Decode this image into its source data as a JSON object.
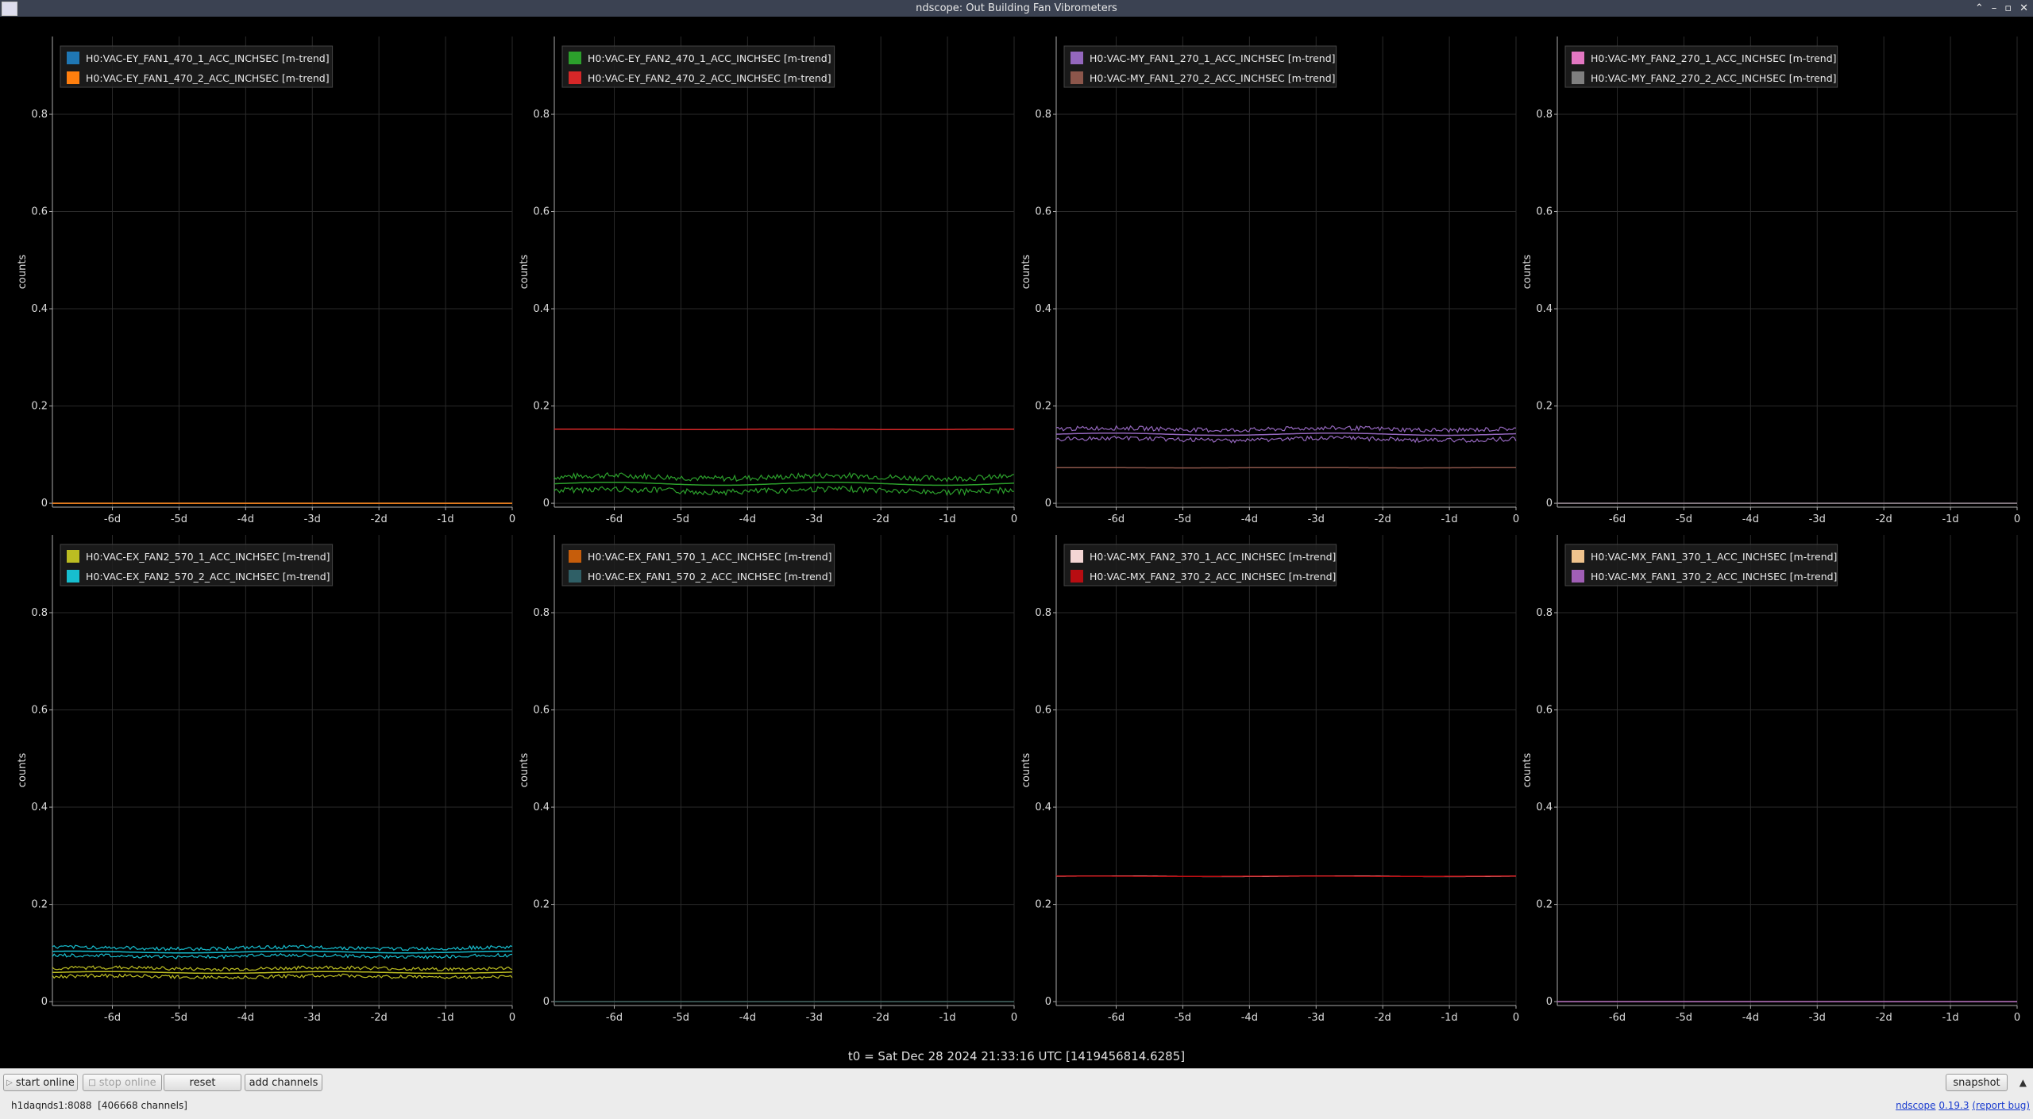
{
  "window": {
    "title": "ndscope: Out Building Fan Vibrometers"
  },
  "axes": {
    "ylabel": "counts",
    "yticks": [
      "0",
      "0.2",
      "0.4",
      "0.6",
      "0.8"
    ],
    "ytick_values": [
      0,
      0.2,
      0.4,
      0.6,
      0.8
    ],
    "xticks": [
      "-6d",
      "-5d",
      "-4d",
      "-3d",
      "-2d",
      "-1d",
      "0"
    ],
    "xtick_values": [
      -6,
      -5,
      -4,
      -3,
      -2,
      -1,
      0
    ],
    "xlim": [
      -6.9,
      0
    ],
    "ylim": [
      -0.008,
      0.96
    ]
  },
  "t0": "t0 = Sat Dec 28 2024 21:33:16 UTC [1419456814.6285]",
  "chart_data": [
    {
      "type": "line",
      "series": [
        {
          "name": "H0:VAC-EY_FAN1_470_1_ACC_INCHSEC [m-trend]",
          "color": "#1f77b4",
          "value": 0.0,
          "noise": 0
        },
        {
          "name": "H0:VAC-EY_FAN1_470_2_ACC_INCHSEC [m-trend]",
          "color": "#ff7f0e",
          "value": 0.0,
          "noise": 0
        }
      ]
    },
    {
      "type": "line",
      "series": [
        {
          "name": "H0:VAC-EY_FAN2_470_1_ACC_INCHSEC [m-trend]",
          "color": "#2ca02c",
          "value": 0.04,
          "noise": 0.02
        },
        {
          "name": "H0:VAC-EY_FAN2_470_2_ACC_INCHSEC [m-trend]",
          "color": "#d62728",
          "value": 0.152,
          "noise": 0.003
        }
      ]
    },
    {
      "type": "line",
      "series": [
        {
          "name": "H0:VAC-MY_FAN1_270_1_ACC_INCHSEC [m-trend]",
          "color": "#9467bd",
          "value": 0.142,
          "noise": 0.015
        },
        {
          "name": "H0:VAC-MY_FAN1_270_2_ACC_INCHSEC [m-trend]",
          "color": "#8c564b",
          "value": 0.073,
          "noise": 0.002
        }
      ]
    },
    {
      "type": "line",
      "series": [
        {
          "name": "H0:VAC-MY_FAN2_270_1_ACC_INCHSEC [m-trend]",
          "color": "#e377c2",
          "value": 0.0,
          "noise": 0
        },
        {
          "name": "H0:VAC-MY_FAN2_270_2_ACC_INCHSEC [m-trend]",
          "color": "#7f7f7f",
          "value": 0.0,
          "noise": 0
        }
      ]
    },
    {
      "type": "line",
      "series": [
        {
          "name": "H0:VAC-EX_FAN2_570_1_ACC_INCHSEC [m-trend]",
          "color": "#bcbd22",
          "value": 0.06,
          "noise": 0.012
        },
        {
          "name": "H0:VAC-EX_FAN2_570_2_ACC_INCHSEC [m-trend]",
          "color": "#17becf",
          "value": 0.102,
          "noise": 0.012
        }
      ]
    },
    {
      "type": "line",
      "series": [
        {
          "name": "H0:VAC-EX_FAN1_570_1_ACC_INCHSEC [m-trend]",
          "color": "#c65d0b",
          "value": 0.0,
          "noise": 0
        },
        {
          "name": "H0:VAC-EX_FAN1_570_2_ACC_INCHSEC [m-trend]",
          "color": "#2f5f66",
          "value": 0.0,
          "noise": 0
        }
      ]
    },
    {
      "type": "line",
      "series": [
        {
          "name": "H0:VAC-MX_FAN2_370_1_ACC_INCHSEC [m-trend]",
          "color": "#f4d6d4",
          "value": 0.258,
          "noise": 0.004
        },
        {
          "name": "H0:VAC-MX_FAN2_370_2_ACC_INCHSEC [m-trend]",
          "color": "#b80d12",
          "value": 0.258,
          "noise": 0.002
        }
      ]
    },
    {
      "type": "line",
      "series": [
        {
          "name": "H0:VAC-MX_FAN1_370_1_ACC_INCHSEC [m-trend]",
          "color": "#f0c38d",
          "value": 0.0,
          "noise": 0
        },
        {
          "name": "H0:VAC-MX_FAN1_370_2_ACC_INCHSEC [m-trend]",
          "color": "#a15fb6",
          "value": 0.0,
          "noise": 0
        }
      ]
    }
  ],
  "controls": {
    "start_online": "start online",
    "stop_online": "stop online",
    "reset": "reset",
    "add_channels": "add channels",
    "snapshot": "snapshot",
    "menu_arrow": "▲"
  },
  "status": {
    "server": "h1daqnds1:8088",
    "channels": "[406668 channels]",
    "app": "ndscope",
    "version": "0.19.3",
    "report": "(report bug)"
  }
}
